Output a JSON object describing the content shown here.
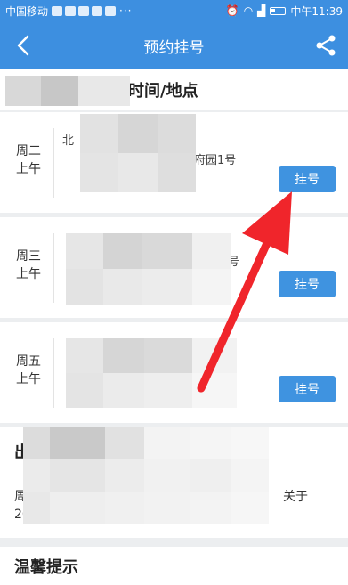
{
  "status_bar": {
    "carrier": "中国移动",
    "time": "中午11:39"
  },
  "header": {
    "title": "预约挂号"
  },
  "schedule": {
    "section_title": "时间/地点",
    "cards": [
      {
        "day": "周二",
        "period": "上午",
        "line1": "北",
        "line2": "府园1号",
        "button": "挂号"
      },
      {
        "day": "周三",
        "period": "上午",
        "line1": "",
        "line2": "号",
        "button": "挂号"
      },
      {
        "day": "周五",
        "period": "上午",
        "line1": "",
        "line2": "",
        "button": "挂号"
      }
    ]
  },
  "notice": {
    "title_fragment": "出",
    "text_left": "周",
    "text_left2": "2019-10-17)",
    "text_right": "关于"
  },
  "tips": {
    "title": "温馨提示"
  }
}
